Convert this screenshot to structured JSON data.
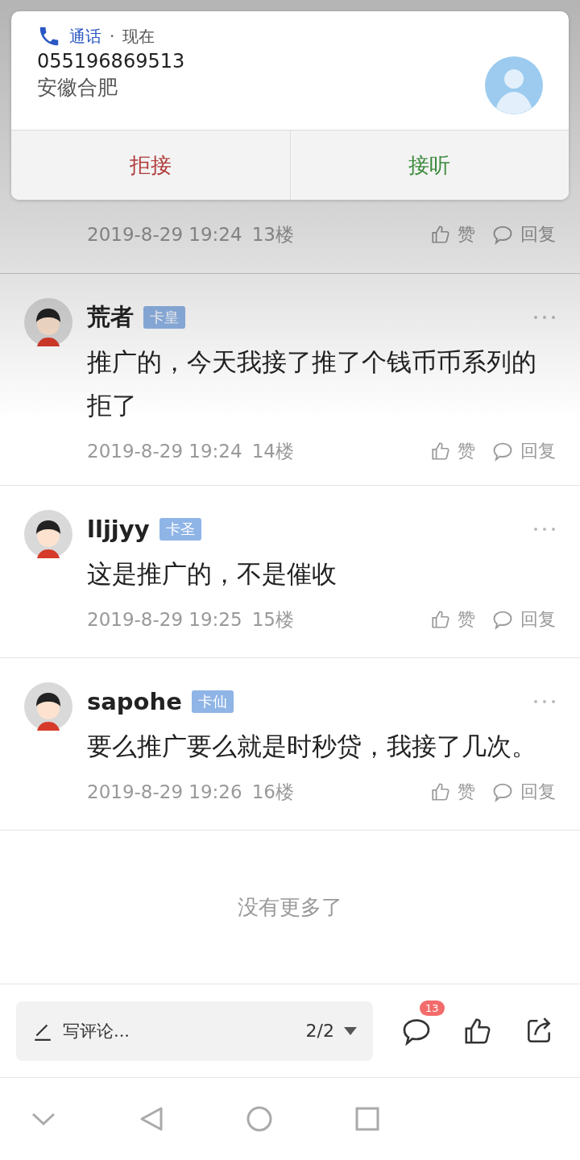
{
  "notification": {
    "app": "通话",
    "separator": "·",
    "time": "现在",
    "number": "055196869513",
    "location": "安徽合肥",
    "buttons": [
      {
        "label": "拒接",
        "kind": "decline"
      },
      {
        "label": "接听",
        "kind": "answer"
      }
    ]
  },
  "comments": [
    {
      "time": "2019-8-29 19:24",
      "floor": "13楼",
      "like": "赞",
      "reply": "回复"
    },
    {
      "name": "荒者",
      "badge": "卡皇",
      "body": "推广的，今天我接了推了个钱币币系列的拒了",
      "time": "2019-8-29 19:24",
      "floor": "14楼",
      "like": "赞",
      "reply": "回复"
    },
    {
      "name": "lljjyy",
      "badge": "卡圣",
      "body": "这是推广的，不是催收",
      "time": "2019-8-29 19:25",
      "floor": "15楼",
      "like": "赞",
      "reply": "回复"
    },
    {
      "name": "sapohe",
      "badge": "卡仙",
      "body": "要么推广要么就是时秒贷，我接了几次。",
      "time": "2019-8-29 19:26",
      "floor": "16楼",
      "like": "赞",
      "reply": "回复"
    }
  ],
  "end_text": "没有更多了",
  "composer": {
    "placeholder": "写评论...",
    "page": "2/2",
    "comment_count": "13"
  }
}
